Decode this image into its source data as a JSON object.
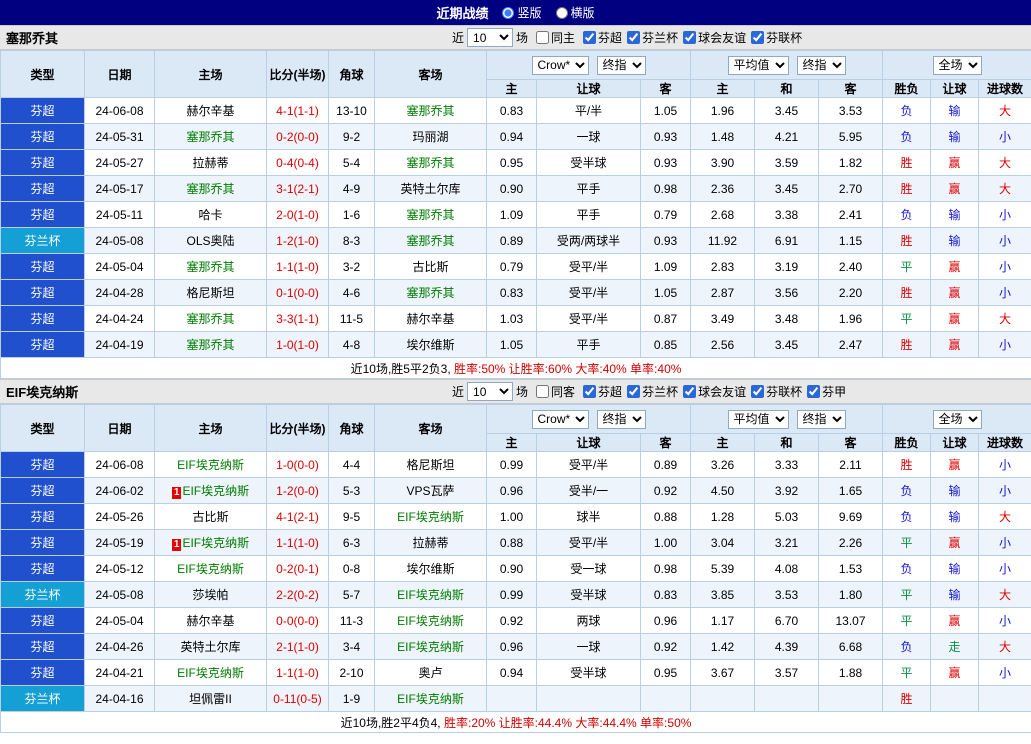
{
  "topbar": {
    "title": "近期战绩",
    "radios": [
      {
        "label": "竖版",
        "checked": true
      },
      {
        "label": "横版",
        "checked": false
      }
    ]
  },
  "table_header": {
    "cols": [
      "类型",
      "日期",
      "主场",
      "比分(半场)",
      "角球",
      "客场"
    ],
    "sub": [
      "主",
      "让球",
      "客",
      "主",
      "和",
      "客",
      "胜负",
      "让球",
      "进球数"
    ],
    "selects": {
      "crow": "Crow*",
      "final": "终指",
      "avg": "平均值",
      "full": "全场"
    }
  },
  "sections": [
    {
      "team": "塞那乔其",
      "filters": {
        "near": "近",
        "count": "10",
        "games": "场",
        "same_label": "同主",
        "same_checked": false,
        "leagues": [
          {
            "label": "芬超",
            "checked": true
          },
          {
            "label": "芬兰杯",
            "checked": true
          },
          {
            "label": "球会友谊",
            "checked": true
          },
          {
            "label": "芬联杯",
            "checked": true
          }
        ]
      },
      "rows": [
        {
          "type": "芬超",
          "date": "24-06-08",
          "home": "赫尔辛基",
          "home_focus": false,
          "score": "4-1(1-1)",
          "corner": "13-10",
          "away": "塞那乔其",
          "away_focus": true,
          "asia_home": "0.83",
          "handicap": "平/半",
          "asia_away": "1.05",
          "eu_home": "1.96",
          "eu_draw": "3.45",
          "eu_away": "3.53",
          "res": [
            "负",
            "输",
            "大"
          ]
        },
        {
          "type": "芬超",
          "date": "24-05-31",
          "home": "塞那乔其",
          "home_focus": true,
          "score": "0-2(0-0)",
          "corner": "9-2",
          "away": "玛丽湖",
          "away_focus": false,
          "asia_home": "0.94",
          "handicap": "一球",
          "asia_away": "0.93",
          "eu_home": "1.48",
          "eu_draw": "4.21",
          "eu_away": "5.95",
          "res": [
            "负",
            "输",
            "小"
          ]
        },
        {
          "type": "芬超",
          "date": "24-05-27",
          "home": "拉赫蒂",
          "home_focus": false,
          "score": "0-4(0-4)",
          "corner": "5-4",
          "away": "塞那乔其",
          "away_focus": true,
          "asia_home": "0.95",
          "handicap": "受半球",
          "asia_away": "0.93",
          "eu_home": "3.90",
          "eu_draw": "3.59",
          "eu_away": "1.82",
          "res": [
            "胜",
            "赢",
            "大"
          ]
        },
        {
          "type": "芬超",
          "date": "24-05-17",
          "home": "塞那乔其",
          "home_focus": true,
          "score": "3-1(2-1)",
          "corner": "4-9",
          "away": "英特土尔库",
          "away_focus": false,
          "asia_home": "0.90",
          "handicap": "平手",
          "asia_away": "0.98",
          "eu_home": "2.36",
          "eu_draw": "3.45",
          "eu_away": "2.70",
          "res": [
            "胜",
            "赢",
            "大"
          ]
        },
        {
          "type": "芬超",
          "date": "24-05-11",
          "home": "哈卡",
          "home_focus": false,
          "score": "2-0(1-0)",
          "corner": "1-6",
          "away": "塞那乔其",
          "away_focus": true,
          "asia_home": "1.09",
          "handicap": "平手",
          "asia_away": "0.79",
          "eu_home": "2.68",
          "eu_draw": "3.38",
          "eu_away": "2.41",
          "res": [
            "负",
            "输",
            "小"
          ]
        },
        {
          "type": "芬兰杯",
          "date": "24-05-08",
          "home": "OLS奥陆",
          "home_focus": false,
          "score": "1-2(1-0)",
          "corner": "8-3",
          "away": "塞那乔其",
          "away_focus": true,
          "asia_home": "0.89",
          "handicap": "受两/两球半",
          "asia_away": "0.93",
          "eu_home": "11.92",
          "eu_draw": "6.91",
          "eu_away": "1.15",
          "res": [
            "胜",
            "输",
            "小"
          ]
        },
        {
          "type": "芬超",
          "date": "24-05-04",
          "home": "塞那乔其",
          "home_focus": true,
          "score": "1-1(1-0)",
          "corner": "3-2",
          "away": "古比斯",
          "away_focus": false,
          "asia_home": "0.79",
          "handicap": "受平/半",
          "asia_away": "1.09",
          "eu_home": "2.83",
          "eu_draw": "3.19",
          "eu_away": "2.40",
          "res": [
            "平",
            "赢",
            "小"
          ]
        },
        {
          "type": "芬超",
          "date": "24-04-28",
          "home": "格尼斯坦",
          "home_focus": false,
          "score": "0-1(0-0)",
          "corner": "4-6",
          "away": "塞那乔其",
          "away_focus": true,
          "asia_home": "0.83",
          "handicap": "受平/半",
          "asia_away": "1.05",
          "eu_home": "2.87",
          "eu_draw": "3.56",
          "eu_away": "2.20",
          "res": [
            "胜",
            "赢",
            "小"
          ]
        },
        {
          "type": "芬超",
          "date": "24-04-24",
          "home": "塞那乔其",
          "home_focus": true,
          "score": "3-3(1-1)",
          "corner": "11-5",
          "away": "赫尔辛基",
          "away_focus": false,
          "asia_home": "1.03",
          "handicap": "受平/半",
          "asia_away": "0.87",
          "eu_home": "3.49",
          "eu_draw": "3.48",
          "eu_away": "1.96",
          "res": [
            "平",
            "赢",
            "大"
          ]
        },
        {
          "type": "芬超",
          "date": "24-04-19",
          "home": "塞那乔其",
          "home_focus": true,
          "score": "1-0(1-0)",
          "corner": "4-8",
          "away": "埃尔维斯",
          "away_focus": false,
          "asia_home": "1.05",
          "handicap": "平手",
          "asia_away": "0.85",
          "eu_home": "2.56",
          "eu_draw": "3.45",
          "eu_away": "2.47",
          "res": [
            "胜",
            "赢",
            "小"
          ]
        }
      ],
      "summary_intro": "近10场,胜5平2负3,",
      "summary_stats": "胜率:50% 让胜率:60% 大率:40% 单率:40%"
    },
    {
      "team": "EIF埃克纳斯",
      "filters": {
        "near": "近",
        "count": "10",
        "games": "场",
        "same_label": "同客",
        "same_checked": false,
        "leagues": [
          {
            "label": "芬超",
            "checked": true
          },
          {
            "label": "芬兰杯",
            "checked": true
          },
          {
            "label": "球会友谊",
            "checked": true
          },
          {
            "label": "芬联杯",
            "checked": true
          },
          {
            "label": "芬甲",
            "checked": true
          }
        ]
      },
      "rows": [
        {
          "type": "芬超",
          "date": "24-06-08",
          "home": "EIF埃克纳斯",
          "home_focus": true,
          "score": "1-0(0-0)",
          "corner": "4-4",
          "away": "格尼斯坦",
          "away_focus": false,
          "asia_home": "0.99",
          "handicap": "受平/半",
          "asia_away": "0.89",
          "eu_home": "3.26",
          "eu_draw": "3.33",
          "eu_away": "2.11",
          "res": [
            "胜",
            "赢",
            "小"
          ]
        },
        {
          "type": "芬超",
          "date": "24-06-02",
          "home": "EIF埃克纳斯",
          "home_focus": true,
          "badge": "1",
          "score": "1-2(0-0)",
          "corner": "5-3",
          "away": "VPS瓦萨",
          "away_focus": false,
          "asia_home": "0.96",
          "handicap": "受半/一",
          "asia_away": "0.92",
          "eu_home": "4.50",
          "eu_draw": "3.92",
          "eu_away": "1.65",
          "res": [
            "负",
            "输",
            "小"
          ]
        },
        {
          "type": "芬超",
          "date": "24-05-26",
          "home": "古比斯",
          "home_focus": false,
          "score": "4-1(2-1)",
          "corner": "9-5",
          "away": "EIF埃克纳斯",
          "away_focus": true,
          "asia_home": "1.00",
          "handicap": "球半",
          "asia_away": "0.88",
          "eu_home": "1.28",
          "eu_draw": "5.03",
          "eu_away": "9.69",
          "res": [
            "负",
            "输",
            "大"
          ]
        },
        {
          "type": "芬超",
          "date": "24-05-19",
          "home": "EIF埃克纳斯",
          "home_focus": true,
          "badge": "1",
          "score": "1-1(1-0)",
          "corner": "6-3",
          "away": "拉赫蒂",
          "away_focus": false,
          "asia_home": "0.88",
          "handicap": "受平/半",
          "asia_away": "1.00",
          "eu_home": "3.04",
          "eu_draw": "3.21",
          "eu_away": "2.26",
          "res": [
            "平",
            "赢",
            "小"
          ]
        },
        {
          "type": "芬超",
          "date": "24-05-12",
          "home": "EIF埃克纳斯",
          "home_focus": true,
          "score": "0-2(0-1)",
          "corner": "0-8",
          "away": "埃尔维斯",
          "away_focus": false,
          "asia_home": "0.90",
          "handicap": "受一球",
          "asia_away": "0.98",
          "eu_home": "5.39",
          "eu_draw": "4.08",
          "eu_away": "1.53",
          "res": [
            "负",
            "输",
            "小"
          ]
        },
        {
          "type": "芬兰杯",
          "date": "24-05-08",
          "home": "莎埃帕",
          "home_focus": false,
          "score": "2-2(0-2)",
          "corner": "5-7",
          "away": "EIF埃克纳斯",
          "away_focus": true,
          "asia_home": "0.99",
          "handicap": "受半球",
          "asia_away": "0.83",
          "eu_home": "3.85",
          "eu_draw": "3.53",
          "eu_away": "1.80",
          "res": [
            "平",
            "输",
            "大"
          ]
        },
        {
          "type": "芬超",
          "date": "24-05-04",
          "home": "赫尔辛基",
          "home_focus": false,
          "score": "0-0(0-0)",
          "corner": "11-3",
          "away": "EIF埃克纳斯",
          "away_focus": true,
          "asia_home": "0.92",
          "handicap": "两球",
          "asia_away": "0.96",
          "eu_home": "1.17",
          "eu_draw": "6.70",
          "eu_away": "13.07",
          "res": [
            "平",
            "赢",
            "小"
          ]
        },
        {
          "type": "芬超",
          "date": "24-04-26",
          "home": "英特土尔库",
          "home_focus": false,
          "score": "2-1(1-0)",
          "corner": "3-4",
          "away": "EIF埃克纳斯",
          "away_focus": true,
          "asia_home": "0.96",
          "handicap": "一球",
          "asia_away": "0.92",
          "eu_home": "1.42",
          "eu_draw": "4.39",
          "eu_away": "6.68",
          "res": [
            "负",
            "走",
            "大"
          ]
        },
        {
          "type": "芬超",
          "date": "24-04-21",
          "home": "EIF埃克纳斯",
          "home_focus": true,
          "score": "1-1(1-0)",
          "corner": "2-10",
          "away": "奥卢",
          "away_focus": false,
          "asia_home": "0.94",
          "handicap": "受半球",
          "asia_away": "0.95",
          "eu_home": "3.67",
          "eu_draw": "3.57",
          "eu_away": "1.88",
          "res": [
            "平",
            "赢",
            "小"
          ]
        },
        {
          "type": "芬兰杯",
          "date": "24-04-16",
          "home": "坦佩雷II",
          "home_focus": false,
          "score": "0-11(0-5)",
          "corner": "1-9",
          "away": "EIF埃克纳斯",
          "away_focus": true,
          "asia_home": "",
          "handicap": "",
          "asia_away": "",
          "eu_home": "",
          "eu_draw": "",
          "eu_away": "",
          "res": [
            "胜",
            "",
            ""
          ]
        }
      ],
      "summary_intro": "近10场,胜2平4负4,",
      "summary_stats": "胜率:20% 让胜率:44.4% 大率:44.4% 单率:50%"
    }
  ]
}
